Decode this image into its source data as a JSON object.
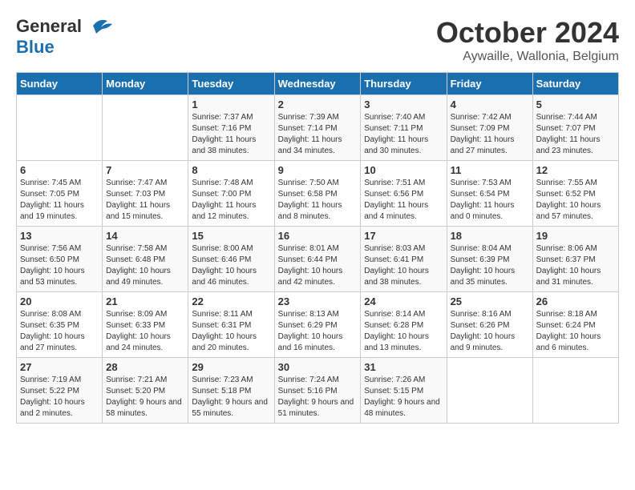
{
  "header": {
    "logo_line1": "General",
    "logo_line2": "Blue",
    "month": "October 2024",
    "location": "Aywaille, Wallonia, Belgium"
  },
  "days_of_week": [
    "Sunday",
    "Monday",
    "Tuesday",
    "Wednesday",
    "Thursday",
    "Friday",
    "Saturday"
  ],
  "weeks": [
    [
      {
        "day": "",
        "sunrise": "",
        "sunset": "",
        "daylight": ""
      },
      {
        "day": "",
        "sunrise": "",
        "sunset": "",
        "daylight": ""
      },
      {
        "day": "1",
        "sunrise": "Sunrise: 7:37 AM",
        "sunset": "Sunset: 7:16 PM",
        "daylight": "Daylight: 11 hours and 38 minutes."
      },
      {
        "day": "2",
        "sunrise": "Sunrise: 7:39 AM",
        "sunset": "Sunset: 7:14 PM",
        "daylight": "Daylight: 11 hours and 34 minutes."
      },
      {
        "day": "3",
        "sunrise": "Sunrise: 7:40 AM",
        "sunset": "Sunset: 7:11 PM",
        "daylight": "Daylight: 11 hours and 30 minutes."
      },
      {
        "day": "4",
        "sunrise": "Sunrise: 7:42 AM",
        "sunset": "Sunset: 7:09 PM",
        "daylight": "Daylight: 11 hours and 27 minutes."
      },
      {
        "day": "5",
        "sunrise": "Sunrise: 7:44 AM",
        "sunset": "Sunset: 7:07 PM",
        "daylight": "Daylight: 11 hours and 23 minutes."
      }
    ],
    [
      {
        "day": "6",
        "sunrise": "Sunrise: 7:45 AM",
        "sunset": "Sunset: 7:05 PM",
        "daylight": "Daylight: 11 hours and 19 minutes."
      },
      {
        "day": "7",
        "sunrise": "Sunrise: 7:47 AM",
        "sunset": "Sunset: 7:03 PM",
        "daylight": "Daylight: 11 hours and 15 minutes."
      },
      {
        "day": "8",
        "sunrise": "Sunrise: 7:48 AM",
        "sunset": "Sunset: 7:00 PM",
        "daylight": "Daylight: 11 hours and 12 minutes."
      },
      {
        "day": "9",
        "sunrise": "Sunrise: 7:50 AM",
        "sunset": "Sunset: 6:58 PM",
        "daylight": "Daylight: 11 hours and 8 minutes."
      },
      {
        "day": "10",
        "sunrise": "Sunrise: 7:51 AM",
        "sunset": "Sunset: 6:56 PM",
        "daylight": "Daylight: 11 hours and 4 minutes."
      },
      {
        "day": "11",
        "sunrise": "Sunrise: 7:53 AM",
        "sunset": "Sunset: 6:54 PM",
        "daylight": "Daylight: 11 hours and 0 minutes."
      },
      {
        "day": "12",
        "sunrise": "Sunrise: 7:55 AM",
        "sunset": "Sunset: 6:52 PM",
        "daylight": "Daylight: 10 hours and 57 minutes."
      }
    ],
    [
      {
        "day": "13",
        "sunrise": "Sunrise: 7:56 AM",
        "sunset": "Sunset: 6:50 PM",
        "daylight": "Daylight: 10 hours and 53 minutes."
      },
      {
        "day": "14",
        "sunrise": "Sunrise: 7:58 AM",
        "sunset": "Sunset: 6:48 PM",
        "daylight": "Daylight: 10 hours and 49 minutes."
      },
      {
        "day": "15",
        "sunrise": "Sunrise: 8:00 AM",
        "sunset": "Sunset: 6:46 PM",
        "daylight": "Daylight: 10 hours and 46 minutes."
      },
      {
        "day": "16",
        "sunrise": "Sunrise: 8:01 AM",
        "sunset": "Sunset: 6:44 PM",
        "daylight": "Daylight: 10 hours and 42 minutes."
      },
      {
        "day": "17",
        "sunrise": "Sunrise: 8:03 AM",
        "sunset": "Sunset: 6:41 PM",
        "daylight": "Daylight: 10 hours and 38 minutes."
      },
      {
        "day": "18",
        "sunrise": "Sunrise: 8:04 AM",
        "sunset": "Sunset: 6:39 PM",
        "daylight": "Daylight: 10 hours and 35 minutes."
      },
      {
        "day": "19",
        "sunrise": "Sunrise: 8:06 AM",
        "sunset": "Sunset: 6:37 PM",
        "daylight": "Daylight: 10 hours and 31 minutes."
      }
    ],
    [
      {
        "day": "20",
        "sunrise": "Sunrise: 8:08 AM",
        "sunset": "Sunset: 6:35 PM",
        "daylight": "Daylight: 10 hours and 27 minutes."
      },
      {
        "day": "21",
        "sunrise": "Sunrise: 8:09 AM",
        "sunset": "Sunset: 6:33 PM",
        "daylight": "Daylight: 10 hours and 24 minutes."
      },
      {
        "day": "22",
        "sunrise": "Sunrise: 8:11 AM",
        "sunset": "Sunset: 6:31 PM",
        "daylight": "Daylight: 10 hours and 20 minutes."
      },
      {
        "day": "23",
        "sunrise": "Sunrise: 8:13 AM",
        "sunset": "Sunset: 6:29 PM",
        "daylight": "Daylight: 10 hours and 16 minutes."
      },
      {
        "day": "24",
        "sunrise": "Sunrise: 8:14 AM",
        "sunset": "Sunset: 6:28 PM",
        "daylight": "Daylight: 10 hours and 13 minutes."
      },
      {
        "day": "25",
        "sunrise": "Sunrise: 8:16 AM",
        "sunset": "Sunset: 6:26 PM",
        "daylight": "Daylight: 10 hours and 9 minutes."
      },
      {
        "day": "26",
        "sunrise": "Sunrise: 8:18 AM",
        "sunset": "Sunset: 6:24 PM",
        "daylight": "Daylight: 10 hours and 6 minutes."
      }
    ],
    [
      {
        "day": "27",
        "sunrise": "Sunrise: 7:19 AM",
        "sunset": "Sunset: 5:22 PM",
        "daylight": "Daylight: 10 hours and 2 minutes."
      },
      {
        "day": "28",
        "sunrise": "Sunrise: 7:21 AM",
        "sunset": "Sunset: 5:20 PM",
        "daylight": "Daylight: 9 hours and 58 minutes."
      },
      {
        "day": "29",
        "sunrise": "Sunrise: 7:23 AM",
        "sunset": "Sunset: 5:18 PM",
        "daylight": "Daylight: 9 hours and 55 minutes."
      },
      {
        "day": "30",
        "sunrise": "Sunrise: 7:24 AM",
        "sunset": "Sunset: 5:16 PM",
        "daylight": "Daylight: 9 hours and 51 minutes."
      },
      {
        "day": "31",
        "sunrise": "Sunrise: 7:26 AM",
        "sunset": "Sunset: 5:15 PM",
        "daylight": "Daylight: 9 hours and 48 minutes."
      },
      {
        "day": "",
        "sunrise": "",
        "sunset": "",
        "daylight": ""
      },
      {
        "day": "",
        "sunrise": "",
        "sunset": "",
        "daylight": ""
      }
    ]
  ]
}
